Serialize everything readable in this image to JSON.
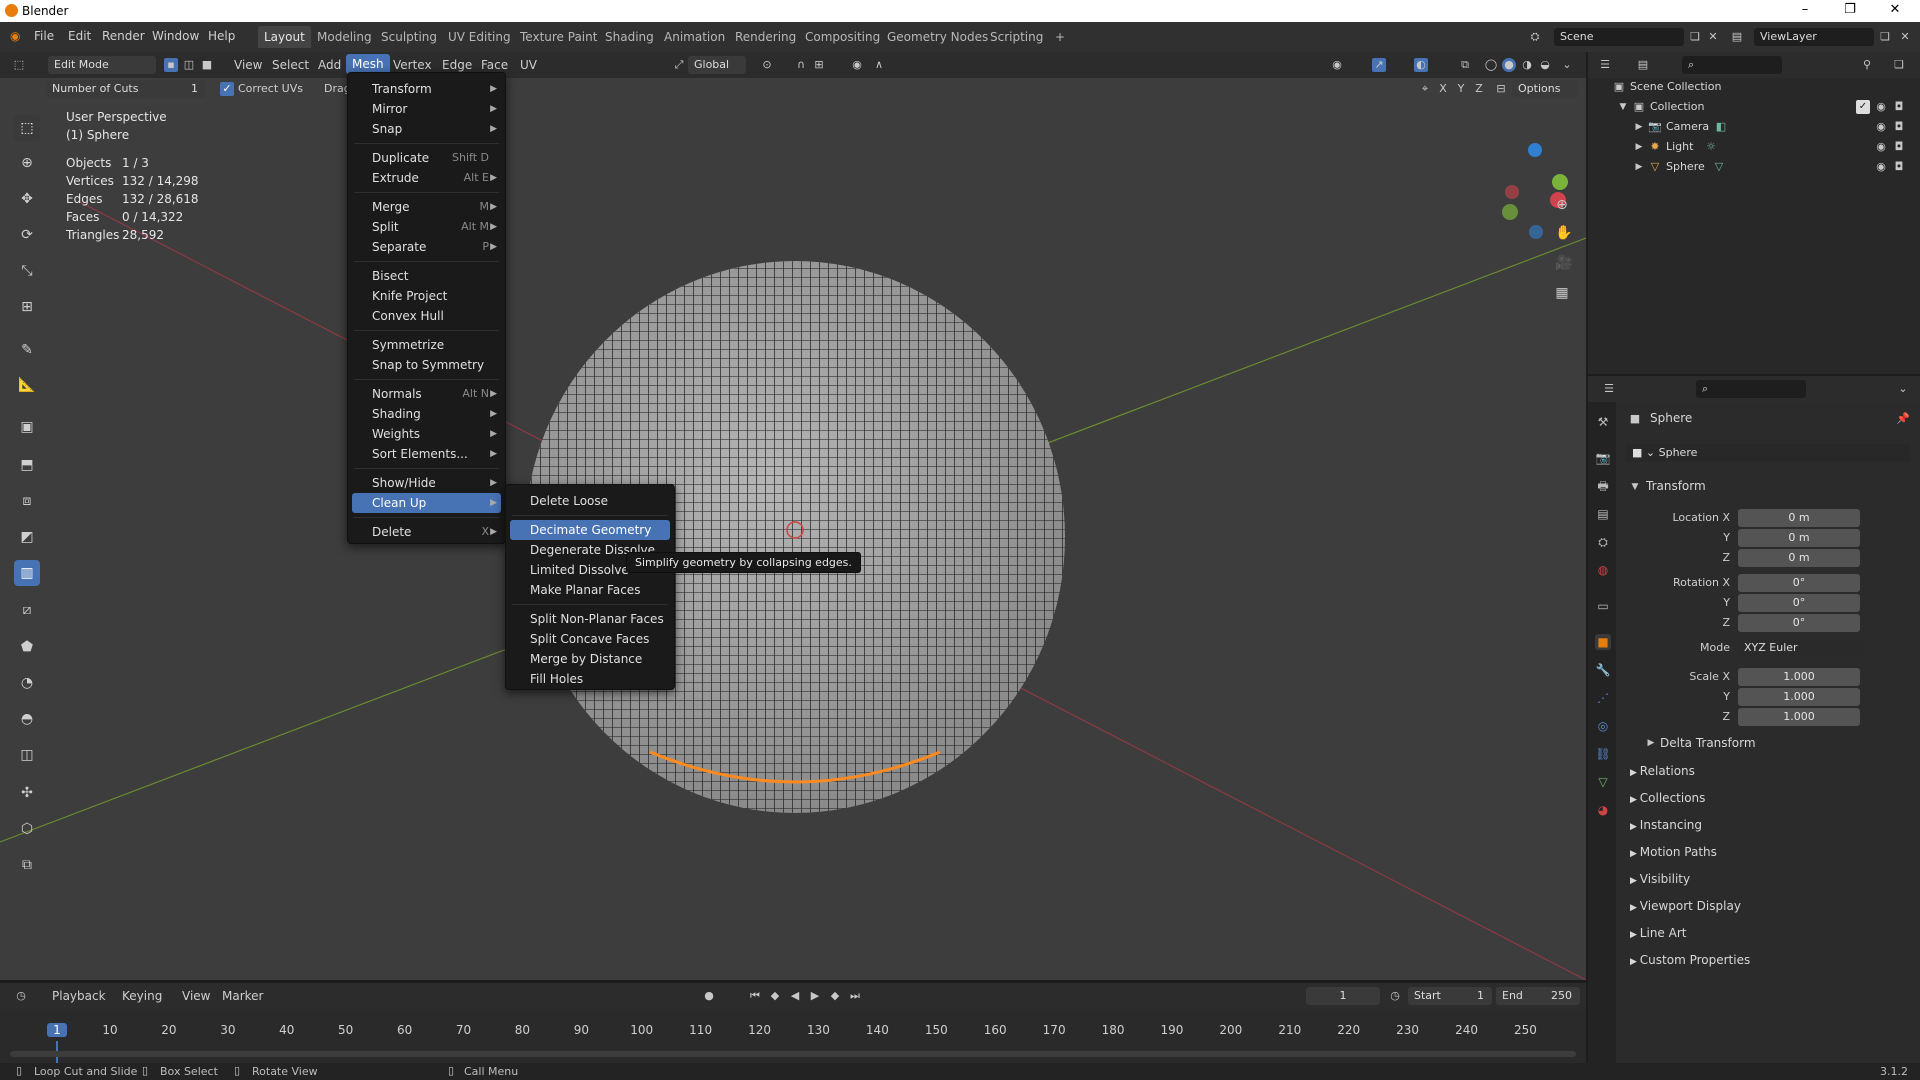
{
  "window": {
    "title": "Blender"
  },
  "top_menu": [
    "File",
    "Edit",
    "Render",
    "Window",
    "Help"
  ],
  "workspaces": [
    "Layout",
    "Modeling",
    "Sculpting",
    "UV Editing",
    "Texture Paint",
    "Shading",
    "Animation",
    "Rendering",
    "Compositing",
    "Geometry Nodes",
    "Scripting",
    "+"
  ],
  "scene": {
    "name": "Scene",
    "view_layer": "ViewLayer"
  },
  "viewport_header": {
    "mode": "Edit Mode",
    "menus": [
      "View",
      "Select",
      "Add",
      "Mesh",
      "Vertex",
      "Edge",
      "Face",
      "UV"
    ],
    "transform_orientation": "Global",
    "options_label": "Options",
    "axes": [
      "X",
      "Y",
      "Z"
    ]
  },
  "operator_bar": {
    "number_of_cuts_label": "Number of Cuts",
    "number_of_cuts_value": "1",
    "correct_uvs_label": "Correct UVs",
    "drag_label": "Drag"
  },
  "stats": {
    "perspective": "User Perspective",
    "object": "(1) Sphere",
    "rows": [
      {
        "label": "Objects",
        "value": "1 / 3"
      },
      {
        "label": "Vertices",
        "value": "132 / 14,298"
      },
      {
        "label": "Edges",
        "value": "132 / 28,618"
      },
      {
        "label": "Faces",
        "value": "0 / 14,322"
      },
      {
        "label": "Triangles",
        "value": "28,592"
      }
    ]
  },
  "mesh_menu": [
    {
      "label": "Transform",
      "arrow": true
    },
    {
      "label": "Mirror",
      "arrow": true
    },
    {
      "label": "Snap",
      "arrow": true
    },
    {
      "sep": true
    },
    {
      "label": "Duplicate",
      "shortcut": "Shift D"
    },
    {
      "label": "Extrude",
      "shortcut": "Alt E",
      "arrow": true
    },
    {
      "sep": true
    },
    {
      "label": "Merge",
      "shortcut": "M",
      "arrow": true
    },
    {
      "label": "Split",
      "shortcut": "Alt M",
      "arrow": true
    },
    {
      "label": "Separate",
      "shortcut": "P",
      "arrow": true
    },
    {
      "sep": true
    },
    {
      "label": "Bisect"
    },
    {
      "label": "Knife Project"
    },
    {
      "label": "Convex Hull"
    },
    {
      "sep": true
    },
    {
      "label": "Symmetrize"
    },
    {
      "label": "Snap to Symmetry"
    },
    {
      "sep": true
    },
    {
      "label": "Normals",
      "shortcut": "Alt N",
      "arrow": true
    },
    {
      "label": "Shading",
      "arrow": true
    },
    {
      "label": "Weights",
      "arrow": true
    },
    {
      "label": "Sort Elements...",
      "arrow": true
    },
    {
      "sep": true
    },
    {
      "label": "Show/Hide",
      "arrow": true
    },
    {
      "label": "Clean Up",
      "arrow": true,
      "highlight": true
    },
    {
      "sep": true
    },
    {
      "label": "Delete",
      "shortcut": "X",
      "arrow": true
    }
  ],
  "cleanup_menu": [
    {
      "label": "Delete Loose"
    },
    {
      "sep": true
    },
    {
      "label": "Decimate Geometry",
      "highlight": true
    },
    {
      "label": "Degenerate Dissolve"
    },
    {
      "label": "Limited Dissolve"
    },
    {
      "label": "Make Planar Faces"
    },
    {
      "sep": true
    },
    {
      "label": "Split Non-Planar Faces"
    },
    {
      "label": "Split Concave Faces"
    },
    {
      "label": "Merge by Distance"
    },
    {
      "label": "Fill Holes"
    }
  ],
  "tooltip": "Simplify geometry by collapsing edges.",
  "outliner": {
    "root": "Scene Collection",
    "collection": "Collection",
    "items": [
      "Camera",
      "Light",
      "Sphere"
    ]
  },
  "properties": {
    "object_name": "Sphere",
    "data_name": "Sphere",
    "transform_label": "Transform",
    "location_label": "Location X",
    "location": [
      "0 m",
      "0 m",
      "0 m"
    ],
    "rotation_label": "Rotation X",
    "rotation": [
      "0°",
      "0°",
      "0°"
    ],
    "mode_label": "Mode",
    "mode_value": "XYZ Euler",
    "scale_label": "Scale X",
    "scale": [
      "1.000",
      "1.000",
      "1.000"
    ],
    "axis_labels": [
      "Y",
      "Z"
    ],
    "delta_transform": "Delta Transform",
    "panels": [
      "Relations",
      "Collections",
      "Instancing",
      "Motion Paths",
      "Visibility",
      "Viewport Display",
      "Line Art",
      "Custom Properties"
    ]
  },
  "timeline": {
    "menus": [
      "Playback",
      "Keying",
      "View",
      "Marker"
    ],
    "current_frame": "1",
    "start_label": "Start",
    "start": "1",
    "end_label": "End",
    "end": "250",
    "ticks": [
      "1",
      "10",
      "20",
      "30",
      "40",
      "50",
      "60",
      "70",
      "80",
      "90",
      "100",
      "110",
      "120",
      "130",
      "140",
      "150",
      "160",
      "170",
      "180",
      "190",
      "200",
      "210",
      "220",
      "230",
      "240",
      "250"
    ]
  },
  "statusbar": {
    "items": [
      "Loop Cut and Slide",
      "Box Select",
      "Rotate View",
      "Call Menu"
    ],
    "version": "3.1.2"
  },
  "colors": {
    "accent": "#4772b3",
    "x_axis": "#d0424e",
    "y_axis": "#7bb33a",
    "z_axis": "#2f80d0",
    "selection": "#ff8a1f"
  }
}
